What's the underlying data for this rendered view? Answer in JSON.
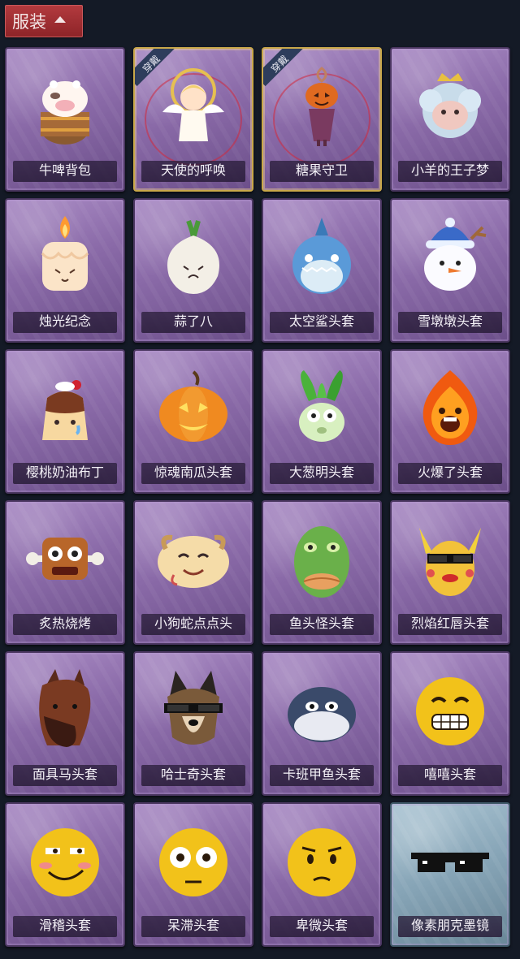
{
  "header": {
    "title": "服装",
    "icon": "caret-up-icon"
  },
  "badge_text": "穿戴",
  "items": [
    {
      "label": "牛啤背包",
      "equipped": false,
      "style": "purple",
      "icon": "cow-backpack-icon"
    },
    {
      "label": "天使的呼唤",
      "equipped": true,
      "style": "purple",
      "icon": "angel-icon"
    },
    {
      "label": "糖果守卫",
      "equipped": true,
      "style": "purple",
      "icon": "pumpkin-guard-icon"
    },
    {
      "label": "小羊的王子梦",
      "equipped": false,
      "style": "purple",
      "icon": "sheep-prince-icon"
    },
    {
      "label": "烛光纪念",
      "equipped": false,
      "style": "purple",
      "icon": "candle-icon"
    },
    {
      "label": "蒜了八",
      "equipped": false,
      "style": "purple",
      "icon": "garlic-icon"
    },
    {
      "label": "太空鲨头套",
      "equipped": false,
      "style": "purple",
      "icon": "shark-icon"
    },
    {
      "label": "雪墩墩头套",
      "equipped": false,
      "style": "purple",
      "icon": "snowman-icon"
    },
    {
      "label": "樱桃奶油布丁",
      "equipped": false,
      "style": "purple",
      "icon": "pudding-icon"
    },
    {
      "label": "惊魂南瓜头套",
      "equipped": false,
      "style": "purple",
      "icon": "pumpkin-icon"
    },
    {
      "label": "大葱明头套",
      "equipped": false,
      "style": "purple",
      "icon": "scallion-icon"
    },
    {
      "label": "火爆了头套",
      "equipped": false,
      "style": "purple",
      "icon": "fireball-icon"
    },
    {
      "label": "炙热烧烤",
      "equipped": false,
      "style": "purple",
      "icon": "bbq-meat-icon"
    },
    {
      "label": "小狗蛇点点头",
      "equipped": false,
      "style": "purple",
      "icon": "dog-snake-icon"
    },
    {
      "label": "鱼头怪头套",
      "equipped": false,
      "style": "purple",
      "icon": "fish-head-icon"
    },
    {
      "label": "烈焰红唇头套",
      "equipped": false,
      "style": "purple",
      "icon": "red-lips-icon"
    },
    {
      "label": "面具马头套",
      "equipped": false,
      "style": "purple",
      "icon": "horse-mask-icon"
    },
    {
      "label": "哈士奇头套",
      "equipped": false,
      "style": "purple",
      "icon": "husky-icon"
    },
    {
      "label": "卡班甲鱼头套",
      "equipped": false,
      "style": "purple",
      "icon": "whale-fish-icon"
    },
    {
      "label": "嘻嘻头套",
      "equipped": false,
      "style": "purple",
      "icon": "grin-emoji-icon"
    },
    {
      "label": "滑稽头套",
      "equipped": false,
      "style": "purple",
      "icon": "funny-emoji-icon"
    },
    {
      "label": "呆滞头套",
      "equipped": false,
      "style": "purple",
      "icon": "dazed-emoji-icon"
    },
    {
      "label": "卑微头套",
      "equipped": false,
      "style": "purple",
      "icon": "humble-emoji-icon"
    },
    {
      "label": "像素朋克墨镜",
      "equipped": false,
      "style": "blue",
      "icon": "pixel-sunglasses-icon"
    }
  ],
  "colors": {
    "accent": "#b23a3e",
    "background": "#141a26",
    "card_purple": "#8a6aa8",
    "card_blue": "#86a4b6",
    "equipped_border": "#c9a84a"
  }
}
